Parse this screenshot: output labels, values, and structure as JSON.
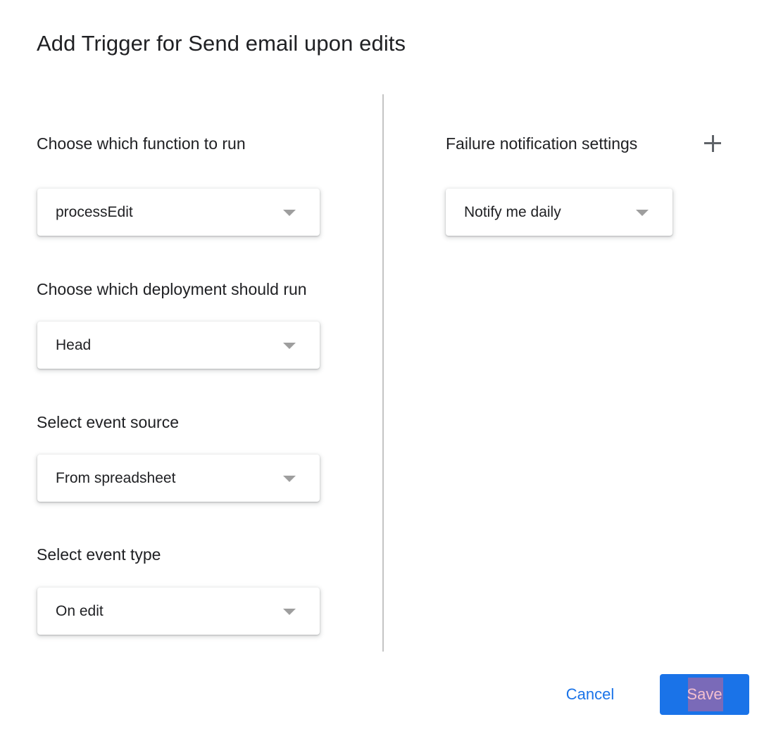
{
  "dialog": {
    "title": "Add Trigger for Send email upon edits"
  },
  "left": {
    "function_label": "Choose which function to run",
    "function_value": "processEdit",
    "deployment_label": "Choose which deployment should run",
    "deployment_value": "Head",
    "event_source_label": "Select event source",
    "event_source_value": "From spreadsheet",
    "event_type_label": "Select event type",
    "event_type_value": "On edit"
  },
  "right": {
    "failure_label": "Failure notification settings",
    "failure_value": "Notify me daily",
    "add_icon": "plus-icon"
  },
  "footer": {
    "cancel_label": "Cancel",
    "save_label": "Save"
  },
  "colors": {
    "accent": "#1a73e8",
    "text": "#202124",
    "caret": "#9e9e9e",
    "divider": "#c4c4c4"
  }
}
